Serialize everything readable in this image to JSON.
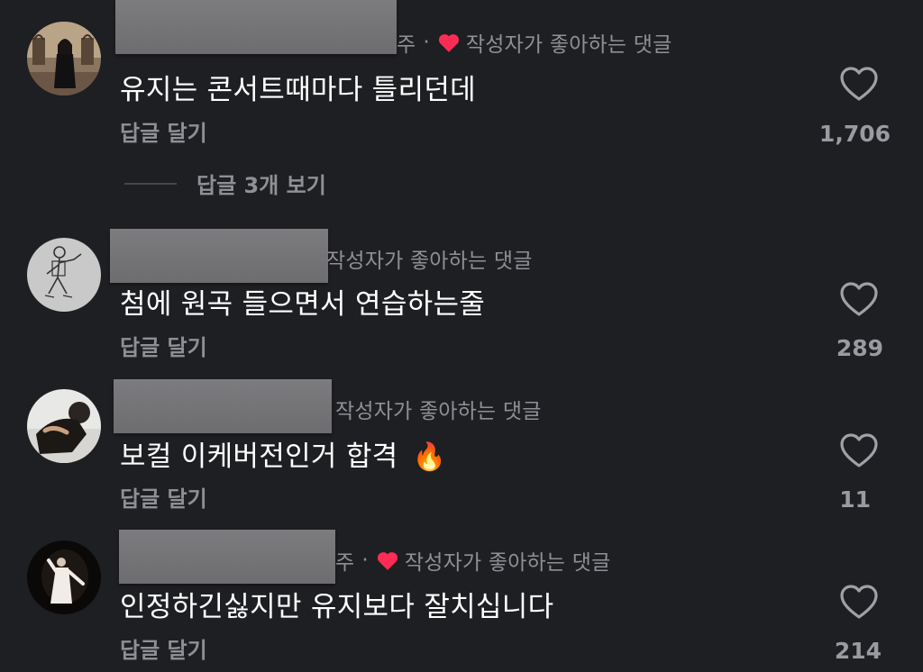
{
  "comments": [
    {
      "partial_name": "주",
      "creator_liked_label": "작성자가 좋아하는 댓글",
      "text": "유지는 콘서트때마다 틀리던데",
      "reply_label": "답글 달기",
      "like_count": "1,706",
      "view_replies_label": "답글 3개 보기",
      "avatar_icon": "profile-photo-woman-standing"
    },
    {
      "creator_liked_label": "작성자가 좋아하는 댓글",
      "text": "첨에 원곡 들으면서 연습하는줄",
      "reply_label": "답글 달기",
      "like_count": "289",
      "avatar_icon": "profile-sketch-figure"
    },
    {
      "creator_liked_label": "작성자가 좋아하는 댓글",
      "text": "보컬 이케버전인거 합격",
      "emoji": "🔥",
      "reply_label": "답글 달기",
      "like_count": "11",
      "avatar_icon": "profile-photo-person"
    },
    {
      "partial_name": "주",
      "creator_liked_label": "작성자가 좋아하는 댓글",
      "text": "인정하긴싫지만 유지보다 잘치십니다",
      "reply_label": "답글 달기",
      "like_count": "214",
      "avatar_icon": "profile-photo-stage-performer"
    }
  ],
  "colors": {
    "background": "#1e1f22",
    "muted_text": "#8f9095",
    "creator_heart": "#fe2c55",
    "redaction": "#737376"
  }
}
